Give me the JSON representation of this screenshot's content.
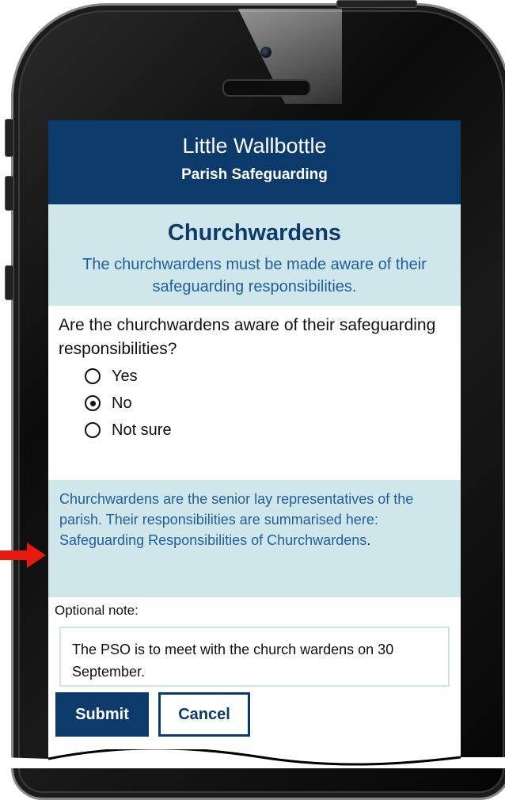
{
  "app": {
    "title": "Little Wallbottle",
    "subtitle": "Parish Safeguarding"
  },
  "section": {
    "title": "Churchwardens",
    "description": "The churchwardens must be made aware of their safeguarding responsibilities."
  },
  "question": {
    "text": "Are the churchwardens aware of their safeguarding responsibilities?",
    "options": [
      {
        "label": "Yes",
        "selected": false
      },
      {
        "label": "No",
        "selected": true
      },
      {
        "label": "Not sure",
        "selected": false
      }
    ]
  },
  "info": {
    "text": "Churchwardens are the senior lay representatives of the parish.  Their responsibilities are summarised here: ",
    "link_text": "Safeguarding Responsibilities of Churchwardens",
    "suffix": "."
  },
  "note": {
    "label": "Optional note:",
    "value": "The PSO is to meet with the church wardens on 30 September."
  },
  "buttons": {
    "submit": "Submit",
    "cancel": "Cancel"
  },
  "icons": {
    "radio_selected": "radio-selected-icon",
    "radio_unselected": "radio-unselected-icon",
    "arrow": "red-arrow-icon",
    "camera": "camera-icon"
  },
  "colors": {
    "primary": "#0b3a6b",
    "panel": "#cfe7ea",
    "link": "#1f5fa0",
    "arrow": "#e8190c"
  }
}
